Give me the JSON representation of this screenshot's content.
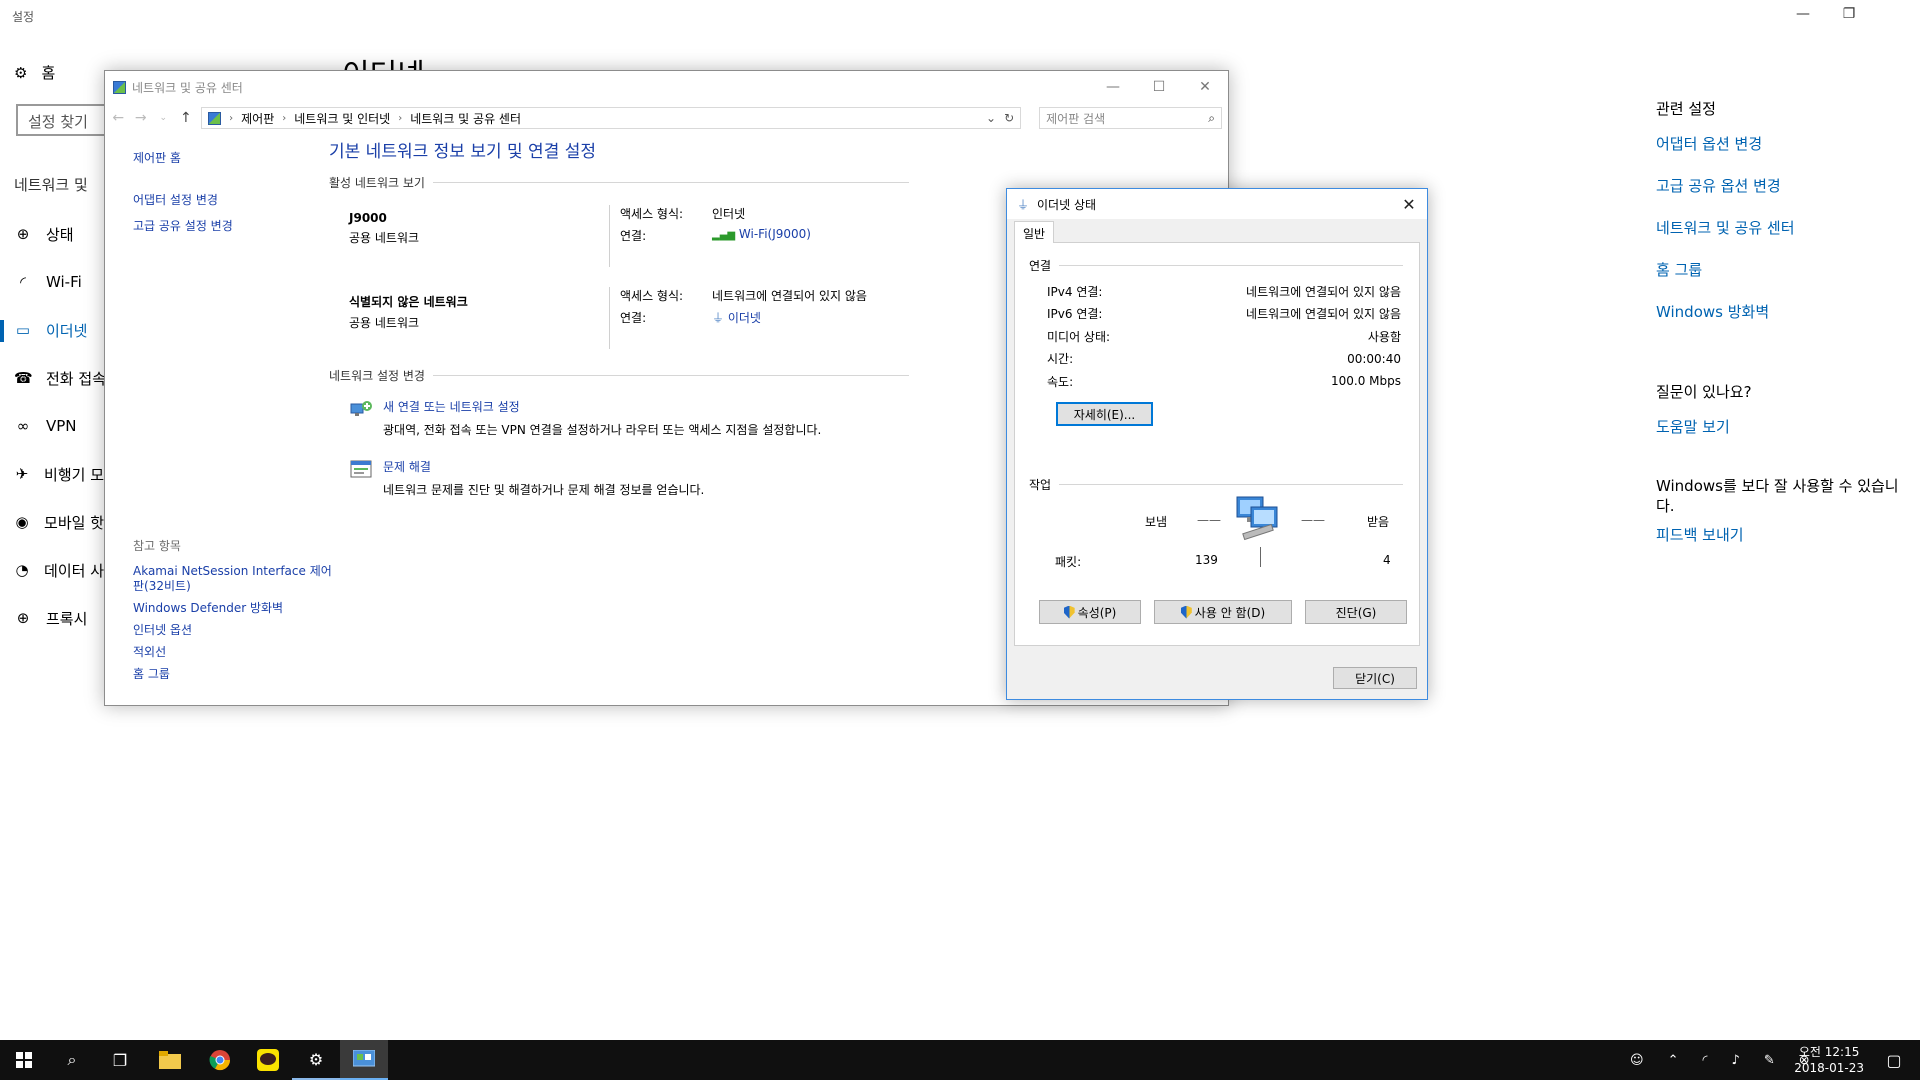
{
  "settings": {
    "app_title": "설정",
    "home_label": "홈",
    "search_placeholder": "설정 찾기",
    "section_label": "네트워크 및",
    "page_heading": "이더넷",
    "nav": [
      {
        "label": "상태",
        "icon": "globe-icon"
      },
      {
        "label": "Wi-Fi",
        "icon": "wifi-icon"
      },
      {
        "label": "이더넷",
        "icon": "ethernet-icon",
        "active": true
      },
      {
        "label": "전화 접속",
        "icon": "dialup-icon"
      },
      {
        "label": "VPN",
        "icon": "vpn-icon"
      },
      {
        "label": "비행기 모",
        "icon": "airplane-icon"
      },
      {
        "label": "모바일 핫",
        "icon": "hotspot-icon"
      },
      {
        "label": "데이터 사",
        "icon": "data-usage-icon"
      },
      {
        "label": "프록시",
        "icon": "proxy-icon"
      }
    ],
    "related": {
      "heading": "관련 설정",
      "links": [
        "어댑터 옵션 변경",
        "고급 공유 옵션 변경",
        "네트워크 및 공유 센터",
        "홈 그룹",
        "Windows 방화벽"
      ],
      "question_heading": "질문이 있나요?",
      "help_link": "도움말 보기",
      "better_text": "Windows를 보다 잘 사용할 수 있습니다.",
      "feedback_link": "피드백 보내기"
    },
    "accent_color": "#0063b1"
  },
  "nsc": {
    "title": "네트워크 및 공유 센터",
    "breadcrumb": [
      "제어판",
      "네트워크 및 인터넷",
      "네트워크 및 공유 센터"
    ],
    "search_placeholder": "제어판 검색",
    "left_links": {
      "home": "제어판 홈",
      "adapter": "어댑터 설정 변경",
      "advanced": "고급 공유 설정 변경"
    },
    "see_also": {
      "header": "참고 항목",
      "items": [
        "Akamai NetSession Interface 제어판(32비트)",
        "Windows Defender 방화벽",
        "인터넷 옵션",
        "적외선",
        "홈 그룹"
      ]
    },
    "heading": "기본 네트워크 정보 보기 및 연결 설정",
    "active_networks_label": "활성 네트워크 보기",
    "networks": [
      {
        "name": "J9000",
        "type": "공용 네트워크",
        "access_label": "액세스 형식:",
        "access_value": "인터넷",
        "conn_label": "연결:",
        "conn_value": "Wi-Fi(J9000)",
        "conn_icon": "wifi-signal-icon"
      },
      {
        "name": "식별되지 않은 네트워크",
        "type": "공용 네트워크",
        "access_label": "액세스 형식:",
        "access_value": "네트워크에 연결되어 있지 않음",
        "conn_label": "연결:",
        "conn_value": "이더넷",
        "conn_icon": "ethernet-plug-icon"
      }
    ],
    "change_settings_label": "네트워크 설정 변경",
    "tasks": [
      {
        "title": "새 연결 또는 네트워크 설정",
        "desc": "광대역, 전화 접속 또는 VPN 연결을 설정하거나 라우터 또는 액세스 지점을 설정합니다."
      },
      {
        "title": "문제 해결",
        "desc": "네트워크 문제를 진단 및 해결하거나 문제 해결 정보를 얻습니다."
      }
    ],
    "link_color": "#1a3fa8"
  },
  "eth": {
    "title": "이더넷 상태",
    "tab": "일반",
    "connection_label": "연결",
    "rows": [
      {
        "k": "IPv4 연결:",
        "v": "네트워크에 연결되어 있지 않음"
      },
      {
        "k": "IPv6 연결:",
        "v": "네트워크에 연결되어 있지 않음"
      },
      {
        "k": "미디어 상태:",
        "v": "사용함"
      },
      {
        "k": "시간:",
        "v": "00:00:40"
      },
      {
        "k": "속도:",
        "v": "100.0 Mbps"
      }
    ],
    "details_button": "자세히(E)...",
    "activity_label": "작업",
    "sent_label": "보냄",
    "received_label": "받음",
    "packets_label": "패킷:",
    "packets_sent": "139",
    "packets_received": "4",
    "properties_button": "속성(P)",
    "disable_button": "사용 안 함(D)",
    "diagnose_button": "진단(G)",
    "close_button": "닫기(C)"
  },
  "taskbar": {
    "clock_time": "오전 12:15",
    "clock_date": "2018-01-23",
    "apps": [
      "start-icon",
      "search-icon",
      "task-view-icon",
      "file-explorer-icon",
      "chrome-icon",
      "kakaotalk-icon",
      "settings-gear-icon",
      "control-panel-icon"
    ]
  }
}
